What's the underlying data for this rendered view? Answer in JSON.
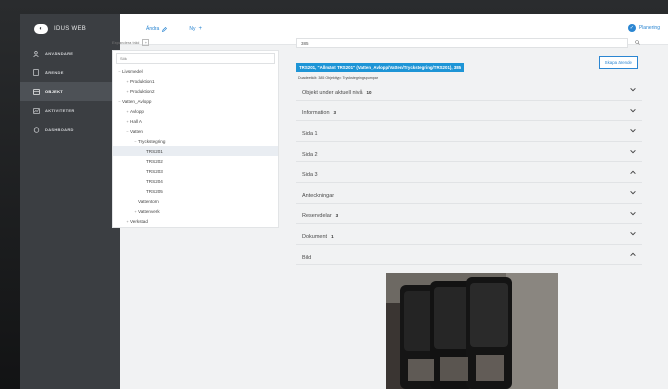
{
  "app": {
    "logo_text": "IDUS WEB"
  },
  "sidebar": {
    "items": [
      {
        "label": "ANVÄNDARE",
        "icon": "user-icon",
        "active": false
      },
      {
        "label": "ÄRENDE",
        "icon": "document-icon",
        "active": false
      },
      {
        "label": "OBJEKT",
        "icon": "objects-icon",
        "active": true
      },
      {
        "label": "AKTIVITETER",
        "icon": "activity-icon",
        "active": false
      },
      {
        "label": "DASHBOARD",
        "icon": "dashboard-icon",
        "active": false
      }
    ]
  },
  "topbar": {
    "edit_label": "Ändra",
    "new_label": "Ny",
    "planner_label": "Planering"
  },
  "tree": {
    "expand_label": "Expandera träd",
    "search_value": "Sök",
    "nodes": [
      {
        "label": "Livsmedel",
        "depth": 0,
        "toggle": "−",
        "selected": false
      },
      {
        "label": "Produktion1",
        "depth": 1,
        "toggle": "+",
        "selected": false
      },
      {
        "label": "Produktion2",
        "depth": 1,
        "toggle": "+",
        "selected": false
      },
      {
        "label": "Vatten_Avlopp",
        "depth": 0,
        "toggle": "−",
        "selected": false
      },
      {
        "label": "Avlopp",
        "depth": 1,
        "toggle": "+",
        "selected": false
      },
      {
        "label": "Hall A",
        "depth": 1,
        "toggle": "+",
        "selected": false
      },
      {
        "label": "Vatten",
        "depth": 1,
        "toggle": "−",
        "selected": false
      },
      {
        "label": "Tryckstegring",
        "depth": 2,
        "toggle": "−",
        "selected": false
      },
      {
        "label": "TRS201",
        "depth": 3,
        "toggle": "",
        "selected": true
      },
      {
        "label": "TRS202",
        "depth": 3,
        "toggle": "",
        "selected": false
      },
      {
        "label": "TRS203",
        "depth": 3,
        "toggle": "",
        "selected": false
      },
      {
        "label": "TRS204",
        "depth": 3,
        "toggle": "",
        "selected": false
      },
      {
        "label": "TRS205",
        "depth": 3,
        "toggle": "",
        "selected": false
      },
      {
        "label": "Vattentorn",
        "depth": 2,
        "toggle": "",
        "selected": false
      },
      {
        "label": "Vattenverk",
        "depth": 2,
        "toggle": "+",
        "selected": false
      },
      {
        "label": "Verkstad",
        "depth": 1,
        "toggle": "+",
        "selected": false
      }
    ]
  },
  "search": {
    "value": "385"
  },
  "object": {
    "title": "TRS201, \"Allmänt TRS201\" (Vatten_Avlopp/Vatten/Tryckstegring/TRS201), 385",
    "subtitle": "Duadeetköt: 385   Objekttyp: Tryckstegringspumpar",
    "create_button": "Skapa ärende"
  },
  "sections": [
    {
      "label": "Objekt under aktuell nivå",
      "count": "10",
      "expanded": false
    },
    {
      "label": "Information",
      "count": "3",
      "expanded": false
    },
    {
      "label": "Sida 1",
      "count": "",
      "expanded": false
    },
    {
      "label": "Sida 2",
      "count": "",
      "expanded": false
    },
    {
      "label": "Sida 3",
      "count": "",
      "expanded": true
    },
    {
      "label": "Anteckningar",
      "count": "",
      "expanded": false
    },
    {
      "label": "Reservdelar",
      "count": "3",
      "expanded": false
    },
    {
      "label": "Dokument",
      "count": "1",
      "expanded": false
    },
    {
      "label": "Bild",
      "count": "",
      "expanded": true
    }
  ],
  "colors": {
    "accent": "#2b86d2",
    "title_bg": "#1e95d6",
    "sidebar": "#3b3e42"
  }
}
